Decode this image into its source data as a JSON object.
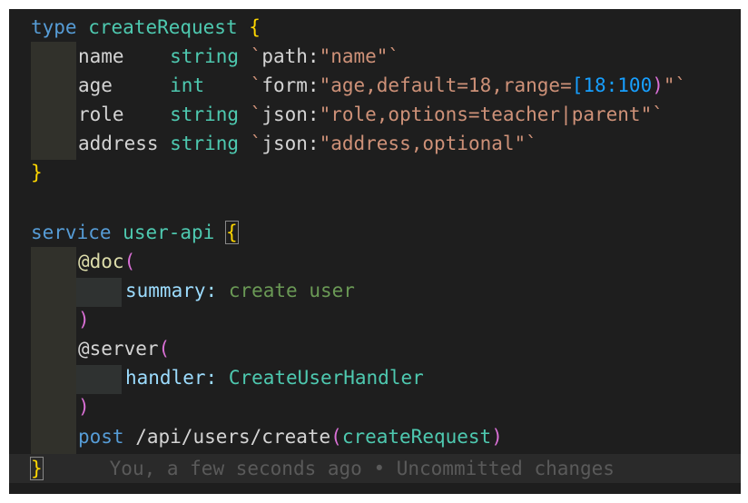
{
  "code": {
    "line1": {
      "keyword": "type",
      "name": "createRequest",
      "brace": "{"
    },
    "fields": [
      {
        "name": "name",
        "type": "string",
        "tag_key": "path",
        "tag_value": "\"name\""
      },
      {
        "name": "age",
        "type": "int",
        "tag_key": "form",
        "tag_value_a": "\"age,default=18,range=",
        "tag_value_b": "[18:100",
        "tag_value_c": ")",
        "tag_value_d": "\""
      },
      {
        "name": "role",
        "type": "string",
        "tag_key": "json",
        "tag_value": "\"role,options=teacher|parent\""
      },
      {
        "name": "address",
        "type": "string",
        "tag_key": "json",
        "tag_value": "\"address,optional\""
      }
    ],
    "close1": "}",
    "service": {
      "keyword": "service",
      "name": "user-api",
      "brace": "{"
    },
    "doc": {
      "annotation": "@doc",
      "open": "(",
      "summary_key": "summary:",
      "summary_value": "create user",
      "close": ")"
    },
    "server": {
      "annotation": "@server",
      "open": "(",
      "handler_key": "handler:",
      "handler_value": "CreateUserHandler",
      "close": ")"
    },
    "route": {
      "method": "post",
      "path": "/api/users/create",
      "open": "(",
      "param": "createRequest",
      "close": ")"
    },
    "close2": "}",
    "blame": "You, a few seconds ago • Uncommitted changes"
  },
  "colors": {
    "background": "#1e1e1e",
    "keyword": "#569cd6",
    "type": "#4ec9b0",
    "bracket": "#ffd700",
    "string": "#ce9178",
    "blame": "#5a5a5a"
  }
}
